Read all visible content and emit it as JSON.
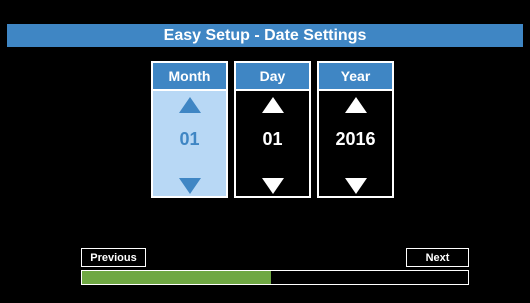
{
  "title": "Easy Setup - Date Settings",
  "columns": [
    {
      "label": "Month",
      "value": "01",
      "selected": true
    },
    {
      "label": "Day",
      "value": "01",
      "selected": false
    },
    {
      "label": "Year",
      "value": "2016",
      "selected": false
    }
  ],
  "buttons": {
    "previous": "Previous",
    "next": "Next"
  },
  "progress": 0.49,
  "colors": {
    "accent": "#3f86c4",
    "selected_bg": "#b8d8f5",
    "progress": "#6fa843",
    "background": "#000000"
  }
}
